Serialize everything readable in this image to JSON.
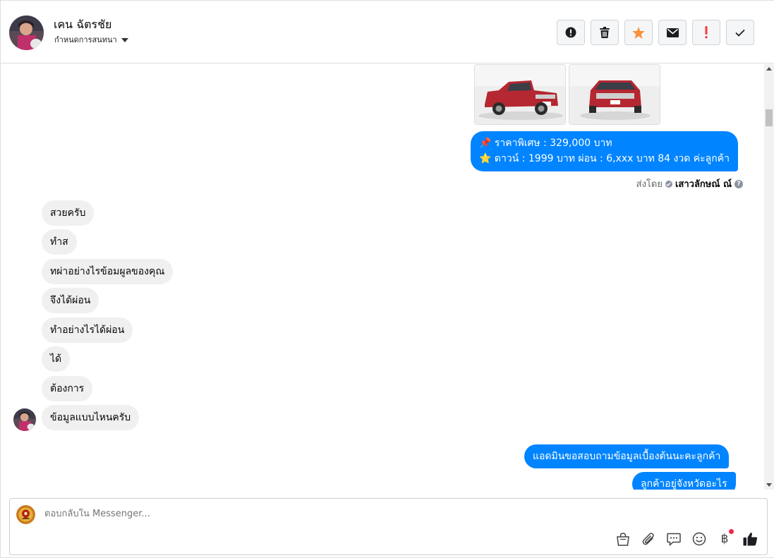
{
  "header": {
    "name": "เคน ฉัตรชัย",
    "subtitle": "กำหนดการสนทนา"
  },
  "actions": [
    {
      "icon": "alert-circle-icon",
      "color": "#1c1e21"
    },
    {
      "icon": "trash-icon",
      "color": "#1c1e21"
    },
    {
      "icon": "star-icon",
      "color": "#f7923a"
    },
    {
      "icon": "envelope-icon",
      "color": "#1c1e21"
    },
    {
      "icon": "exclamation-icon",
      "color": "#fa383e"
    },
    {
      "icon": "check-icon",
      "color": "#1c1e21"
    }
  ],
  "thread": {
    "outgoing_price": {
      "line1": "📌 ราคาพิเศษ : 329,000 บาท",
      "line2": "⭐ ดาวน์ : 1999 บาท ผ่อน : 6,xxx บาท 84 งวด ค่ะลูกค้า"
    },
    "sent_by_prefix": "ส่งโดย",
    "sent_by_name": "เสาวลักษณ์ ณ์",
    "incoming": [
      "สวยครับ",
      "ทำส",
      "ทผ่าอย่างไรข้อมผูลของคุณ",
      "จึงได้ผ่อน",
      "ทำอย่างไรได้ผ่อน",
      "ได้",
      "ต้องการ",
      "ข้อมูลแบบไหนครับ"
    ],
    "outgoing_admin": "แอดมินขอสอบถามข้อมูลเบื้องต้นนะคะลูกค้า",
    "outgoing_region": "ลูกค้าอยู่จังหวัดอะไร"
  },
  "composer": {
    "placeholder": "ตอบกลับใน Messenger...",
    "baht_symbol": "฿",
    "accent": "#0084ff"
  }
}
